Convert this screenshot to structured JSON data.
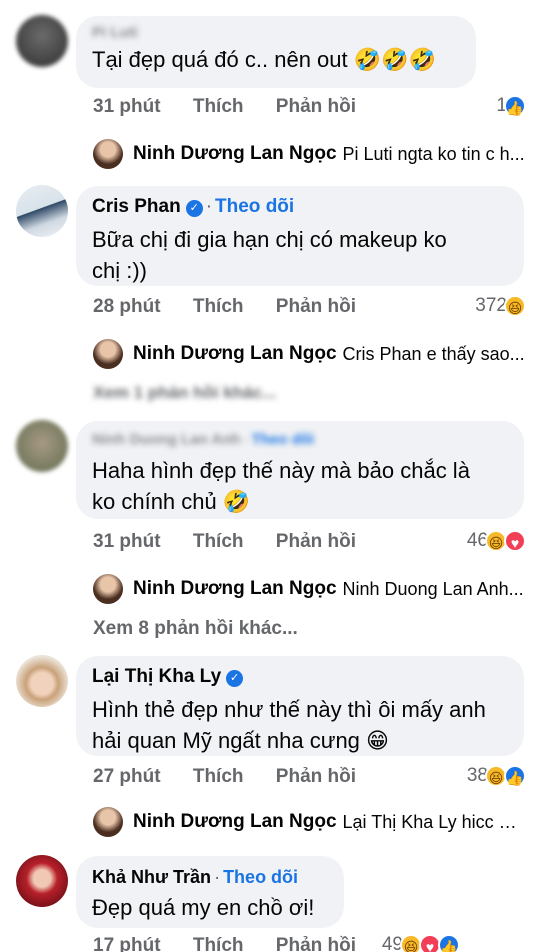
{
  "c1": {
    "author": "Pi Luti",
    "text": "Tại đẹp quá đó c.. nên out 🤣🤣🤣",
    "time": "31 phút",
    "like": "Thích",
    "reply": "Phản hồi",
    "react_count": "1",
    "reply_author": "Ninh Dương Lan Ngọc",
    "reply_snippet": "Pi Luti ngta ko tin c h..."
  },
  "c2": {
    "author": "Cris Phan",
    "follow": "Theo dõi",
    "text_line1": "Bữa chị đi gia hạn chị có makeup ko",
    "text_line2": "chị :))",
    "time": "28 phút",
    "like": "Thích",
    "reply": "Phản hồi",
    "react_count": "372",
    "reply_author": "Ninh Dương Lan Ngọc",
    "reply_snippet": "Cris Phan e thấy sao...",
    "more": "Xem 1 phản hồi khác..."
  },
  "c3": {
    "author": "Ninh Duong Lan Anh",
    "follow": "Theo dõi",
    "text_line1": "Haha hình đẹp thế này mà bảo chắc là",
    "text_line2": "ko chính chủ 🤣",
    "time": "31 phút",
    "like": "Thích",
    "reply": "Phản hồi",
    "react_count": "46",
    "reply_author": "Ninh Dương Lan Ngọc",
    "reply_snippet": "Ninh Duong Lan Anh...",
    "more": "Xem 8 phản hồi khác..."
  },
  "c4": {
    "author": "Lại Thị Kha Ly",
    "text_line1": "Hình thẻ đẹp như thế này thì ôi mấy anh",
    "text_line2": "hải quan Mỹ ngất nha cưng 😁",
    "time": "27 phút",
    "like": "Thích",
    "reply": "Phản hồi",
    "react_count": "38",
    "reply_author": "Ninh Dương Lan Ngọc",
    "reply_snippet": "Lại Thị Kha Ly hicc gi..."
  },
  "c5": {
    "author": "Khả Như Trần",
    "follow": "Theo dõi",
    "text": "Đẹp quá my en chồ ơi!",
    "time": "17 phút",
    "like": "Thích",
    "reply": "Phản hồi",
    "react_count": "49"
  },
  "colors": {
    "bubble": "#f0f2f5",
    "meta": "#65676b",
    "link": "#1b74e4"
  }
}
